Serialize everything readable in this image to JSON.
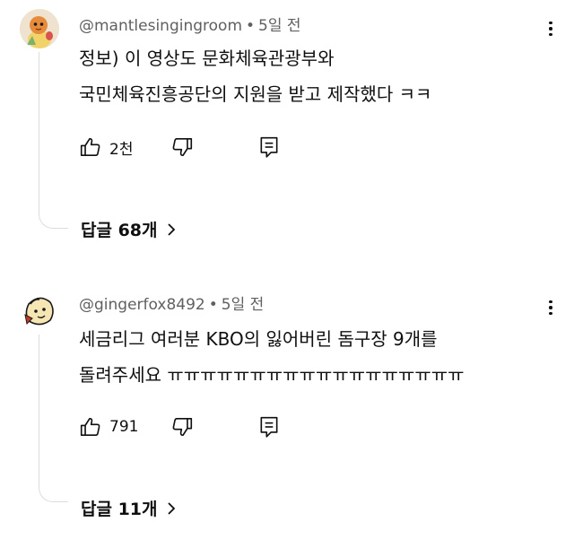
{
  "comments": [
    {
      "author": "@mantlesingingroom",
      "time": "5일 전",
      "separator": "•",
      "text_lines": [
        "정보) 이 영상도 문화체육관광부와",
        "국민체육진흥공단의 지원을 받고 제작했다 ㅋㅋ"
      ],
      "likes": "2천",
      "replies_label": "답글 68개",
      "avatar_icon": "pokemon-character-avatar-icon"
    },
    {
      "author": "@gingerfox8492",
      "time": "5일 전",
      "separator": "•",
      "text_lines": [
        "세금리그 여러분 KBO의 잃어버린 돔구장 9개를",
        "돌려주세요 ㅠㅠㅠㅠㅠㅠㅠㅠㅠㅠㅠㅠㅠㅠㅠㅠㅠㅠ"
      ],
      "likes": "791",
      "replies_label": "답글 11개",
      "avatar_icon": "cartoon-character-avatar-icon"
    }
  ],
  "icons": {
    "like": "thumbs-up-icon",
    "dislike": "thumbs-down-icon",
    "reply": "reply-comment-icon",
    "more": "more-vertical-icon",
    "expand": "chevron-right-icon"
  }
}
